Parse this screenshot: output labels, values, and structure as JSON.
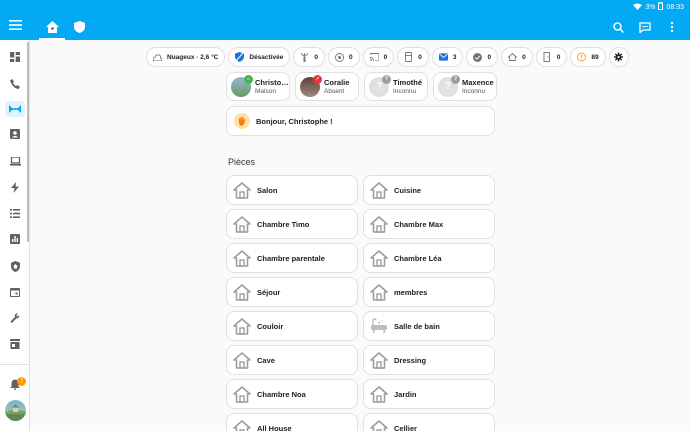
{
  "status_bar": {
    "battery": "3%",
    "time": "08:33"
  },
  "chips": [
    {
      "icon": "weather-cloudy-icon",
      "label": "Nuageux · 2,6 °C"
    },
    {
      "icon": "shield-icon",
      "label": "Désactivée",
      "color": "#1976d2"
    },
    {
      "icon": "sprinkler-icon",
      "label": "0"
    },
    {
      "icon": "fan-icon",
      "label": "0"
    },
    {
      "icon": "cast-icon",
      "label": "0"
    },
    {
      "icon": "fridge-icon",
      "label": "0"
    },
    {
      "icon": "mail-icon",
      "label": "3",
      "color": "#1976d2"
    },
    {
      "icon": "check-circle-icon",
      "label": "0"
    },
    {
      "icon": "home-icon",
      "label": "0"
    },
    {
      "icon": "door-icon",
      "label": "0"
    },
    {
      "icon": "alert-circle-icon",
      "label": "89",
      "color": "#f9a825"
    },
    {
      "icon": "gear-icon",
      "label": ""
    }
  ],
  "people": [
    {
      "name": "Christophe",
      "state": "Maison",
      "badge": "home-icon",
      "badge_color": "#4caf50"
    },
    {
      "name": "Coralie",
      "state": "Absent",
      "badge": "away-icon",
      "badge_color": "#e53935"
    },
    {
      "name": "Timothé",
      "state": "Inconnu",
      "badge": "question-icon",
      "badge_color": "#9e9e9e"
    },
    {
      "name": "Maxence",
      "state": "Inconnu",
      "badge": "question-icon",
      "badge_color": "#9e9e9e"
    }
  ],
  "greeting": "Bonjour, Christophe !",
  "rooms_title": "Pièces",
  "rooms": [
    {
      "name": "Salon",
      "icon": "home-icon"
    },
    {
      "name": "Cuisine",
      "icon": "home-icon"
    },
    {
      "name": "Chambre Timo",
      "icon": "home-icon"
    },
    {
      "name": "Chambre Max",
      "icon": "home-icon"
    },
    {
      "name": "Chambre parentale",
      "icon": "home-icon"
    },
    {
      "name": "Chambre Léa",
      "icon": "home-icon"
    },
    {
      "name": "Séjour",
      "icon": "home-icon"
    },
    {
      "name": "membres",
      "icon": "home-icon"
    },
    {
      "name": "Couloir",
      "icon": "home-icon"
    },
    {
      "name": "Salle de bain",
      "icon": "bathtub-icon"
    },
    {
      "name": "Cave",
      "icon": "home-icon"
    },
    {
      "name": "Dressing",
      "icon": "home-icon"
    },
    {
      "name": "Chambre Noa",
      "icon": "home-icon"
    },
    {
      "name": "Jardin",
      "icon": "home-icon"
    },
    {
      "name": "All House",
      "icon": "home-icon"
    },
    {
      "name": "Cellier",
      "icon": "home-icon"
    }
  ],
  "sidebar_badge": "7",
  "colors": {
    "primary": "#03a9f4",
    "accent": "#ff9800"
  }
}
